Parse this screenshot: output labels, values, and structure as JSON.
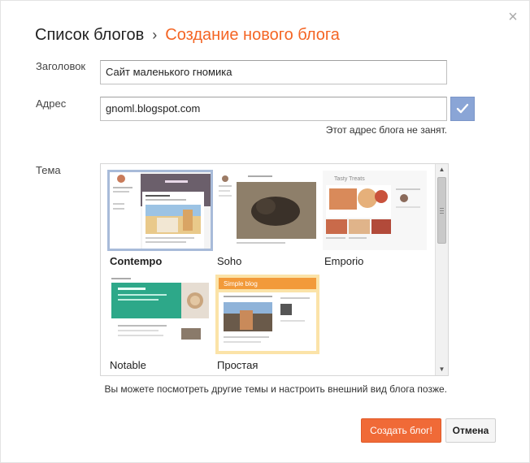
{
  "header": {
    "breadcrumb_root": "Список блогов",
    "separator": "›",
    "breadcrumb_current": "Создание нового блога",
    "close_glyph": "×"
  },
  "form": {
    "title_label": "Заголовок",
    "title_value": "Сайт маленького гномика",
    "address_label": "Адрес",
    "address_value": "gnoml.blogspot.com",
    "address_status": "Этот адрес блога не занят.",
    "theme_label": "Тема"
  },
  "themes": [
    {
      "name": "Contempo",
      "selected": true
    },
    {
      "name": "Soho",
      "selected": false
    },
    {
      "name": "Emporio",
      "selected": false
    },
    {
      "name": "Notable",
      "selected": false
    },
    {
      "name": "Простая",
      "selected": false
    }
  ],
  "thumb_text": {
    "emporio_title": "Tasty Treats",
    "simple_title": "Simple blog"
  },
  "hint": "Вы можете посмотреть другие темы и настроить внешний вид блога позже.",
  "buttons": {
    "create": "Создать блог!",
    "cancel": "Отмена"
  },
  "colors": {
    "accent_orange": "#f46524",
    "create_button": "#f06a37",
    "check_button": "#8aa5d6",
    "selected_outline": "#a8bbd9"
  },
  "icons": {
    "close": "close-icon",
    "check": "checkmark-icon",
    "scroll_up": "scroll-up-arrow-icon",
    "scroll_down": "scroll-down-arrow-icon"
  }
}
